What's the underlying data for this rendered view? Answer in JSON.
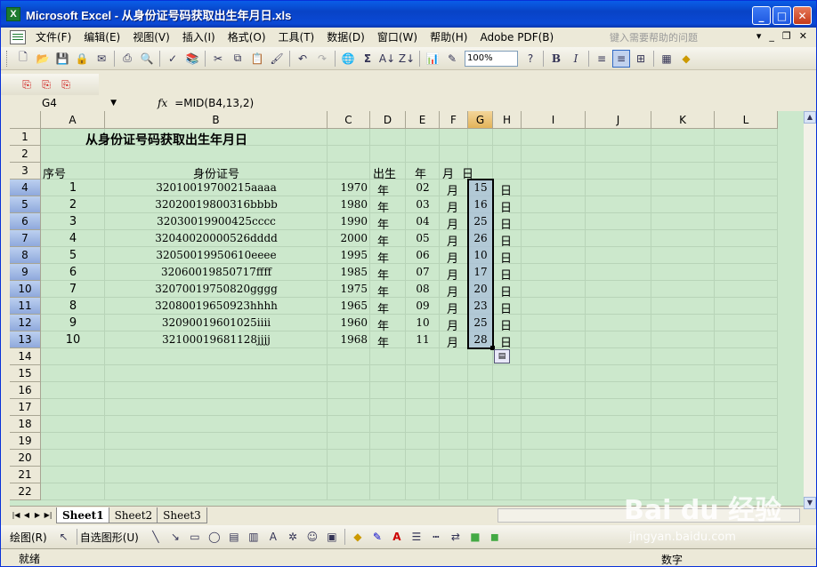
{
  "window": {
    "title": "Microsoft Excel - 从身份证号码获取出生年月日.xls",
    "app_icon": "X"
  },
  "menu": {
    "items": [
      "文件(F)",
      "编辑(E)",
      "视图(V)",
      "插入(I)",
      "格式(O)",
      "工具(T)",
      "数据(D)",
      "窗口(W)",
      "帮助(H)",
      "Adobe PDF(B)"
    ],
    "help_placeholder": "键入需要帮助的问题"
  },
  "toolbar": {
    "zoom": "100%"
  },
  "formula_bar": {
    "name_box": "G4",
    "fx": "fx",
    "formula": "=MID(B4,13,2)"
  },
  "columns": [
    "A",
    "B",
    "C",
    "D",
    "E",
    "F",
    "G",
    "H",
    "I",
    "J",
    "K",
    "L"
  ],
  "rows": [
    "1",
    "2",
    "3",
    "4",
    "5",
    "6",
    "7",
    "8",
    "9",
    "10",
    "11",
    "12",
    "13",
    "14",
    "15",
    "16",
    "17",
    "18",
    "19",
    "20",
    "21",
    "22"
  ],
  "sheet": {
    "title": "从身份证号码获取出生年月日",
    "headers": {
      "seq": "序号",
      "id": "身份证号",
      "born": "出生",
      "year": "年",
      "month": "月",
      "day": "日"
    },
    "records": [
      {
        "seq": "1",
        "id": "32010019700215aaaa",
        "year": "1970",
        "y": "年",
        "month": "02",
        "m": "月",
        "day": "15",
        "d": "日"
      },
      {
        "seq": "2",
        "id": "32020019800316bbbb",
        "year": "1980",
        "y": "年",
        "month": "03",
        "m": "月",
        "day": "16",
        "d": "日"
      },
      {
        "seq": "3",
        "id": "32030019900425cccc",
        "year": "1990",
        "y": "年",
        "month": "04",
        "m": "月",
        "day": "25",
        "d": "日"
      },
      {
        "seq": "4",
        "id": "32040020000526dddd",
        "year": "2000",
        "y": "年",
        "month": "05",
        "m": "月",
        "day": "26",
        "d": "日"
      },
      {
        "seq": "5",
        "id": "32050019950610eeee",
        "year": "1995",
        "y": "年",
        "month": "06",
        "m": "月",
        "day": "10",
        "d": "日"
      },
      {
        "seq": "6",
        "id": "32060019850717ffff",
        "year": "1985",
        "y": "年",
        "month": "07",
        "m": "月",
        "day": "17",
        "d": "日"
      },
      {
        "seq": "7",
        "id": "32070019750820gggg",
        "year": "1975",
        "y": "年",
        "month": "08",
        "m": "月",
        "day": "20",
        "d": "日"
      },
      {
        "seq": "8",
        "id": "32080019650923hhhh",
        "year": "1965",
        "y": "年",
        "month": "09",
        "m": "月",
        "day": "23",
        "d": "日"
      },
      {
        "seq": "9",
        "id": "32090019601025iiii",
        "year": "1960",
        "y": "年",
        "month": "10",
        "m": "月",
        "day": "25",
        "d": "日"
      },
      {
        "seq": "10",
        "id": "32100019681128jjjj",
        "year": "1968",
        "y": "年",
        "month": "11",
        "m": "月",
        "day": "28",
        "d": "日"
      }
    ]
  },
  "tabs": [
    "Sheet1",
    "Sheet2",
    "Sheet3"
  ],
  "draw": {
    "draw_label": "绘图(R)",
    "autoshape_label": "自选图形(U)"
  },
  "status": {
    "ready": "就绪",
    "mode": "数字"
  },
  "watermark": {
    "brand": "Bai du 经验",
    "url": "jingyan.baidu.com"
  },
  "colors": {
    "sheet_bg": "#cce8cc",
    "title_bar": "#0a49d6",
    "selection": "#a9bfd9"
  }
}
